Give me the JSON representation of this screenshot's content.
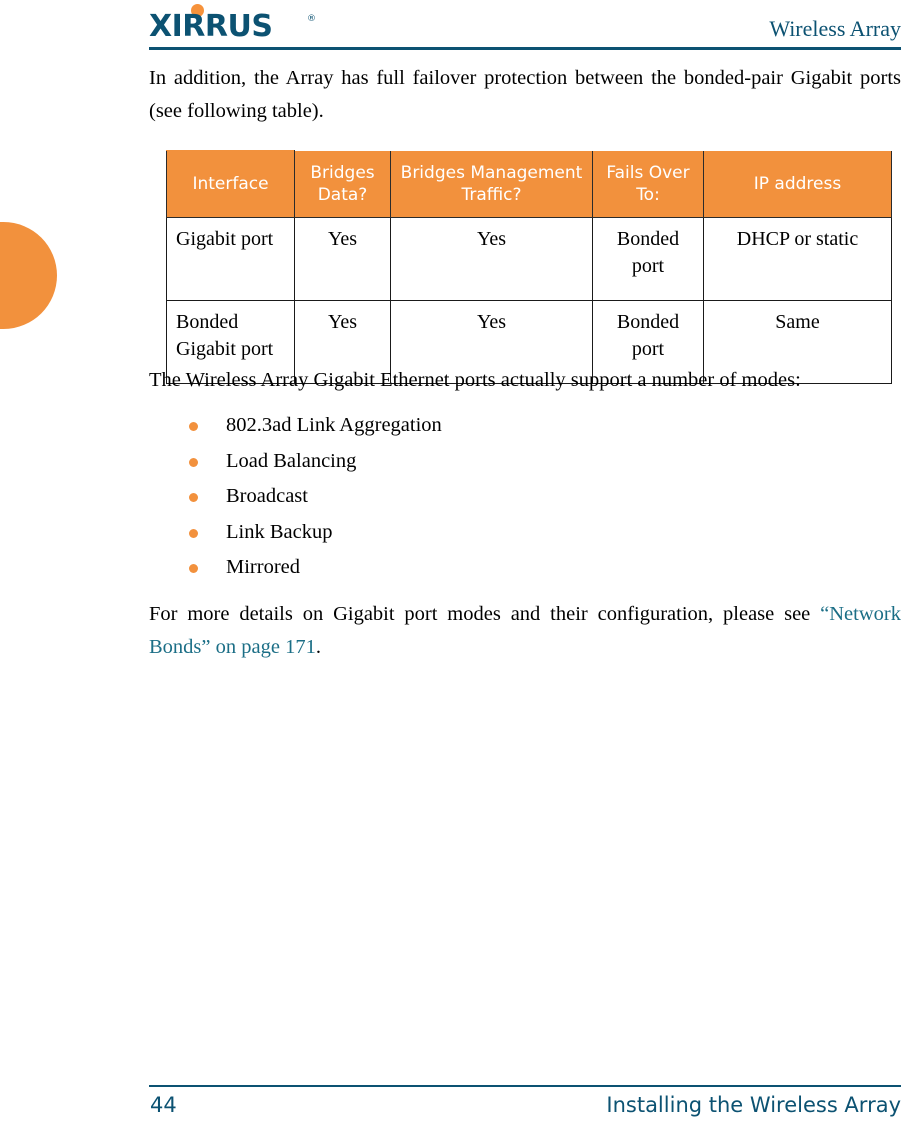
{
  "header": {
    "logo_text": "XIRRUS",
    "logo_trademark": "®",
    "title": "Wireless Array"
  },
  "body": {
    "intro_paragraph": "In addition, the Array has full failover protection between the bonded-pair Gigabit ports (see following table).",
    "modes_lead_in": "The Wireless Array Gigabit Ethernet ports actually support a number of modes:",
    "closing_paragraph_prefix": "For more details on Gigabit port modes and their configuration, please see ",
    "closing_paragraph_link": "“Network Bonds” on page 171",
    "closing_paragraph_suffix": "."
  },
  "table": {
    "headers": [
      "Interface",
      "Bridges Data?",
      "Bridges Management Traffic?",
      "Fails Over To:",
      "IP address"
    ],
    "rows": [
      {
        "interface": "Gigabit port",
        "bridges_data": "Yes",
        "bridges_management_traffic": "Yes",
        "fails_over_to": "Bonded port",
        "ip_address": "DHCP or static"
      },
      {
        "interface": "Bonded Gigabit port",
        "bridges_data": "Yes",
        "bridges_management_traffic": "Yes",
        "fails_over_to": "Bonded port",
        "ip_address": "Same"
      }
    ]
  },
  "modes": [
    "802.3ad Link Aggregation",
    "Load Balancing",
    "Broadcast",
    "Link Backup",
    "Mirrored"
  ],
  "footer": {
    "page_number": "44",
    "section_title": "Installing the Wireless Array"
  },
  "colors": {
    "brand_teal": "#0C5272",
    "accent_orange": "#F2913D",
    "link_teal": "#1B6E86"
  }
}
